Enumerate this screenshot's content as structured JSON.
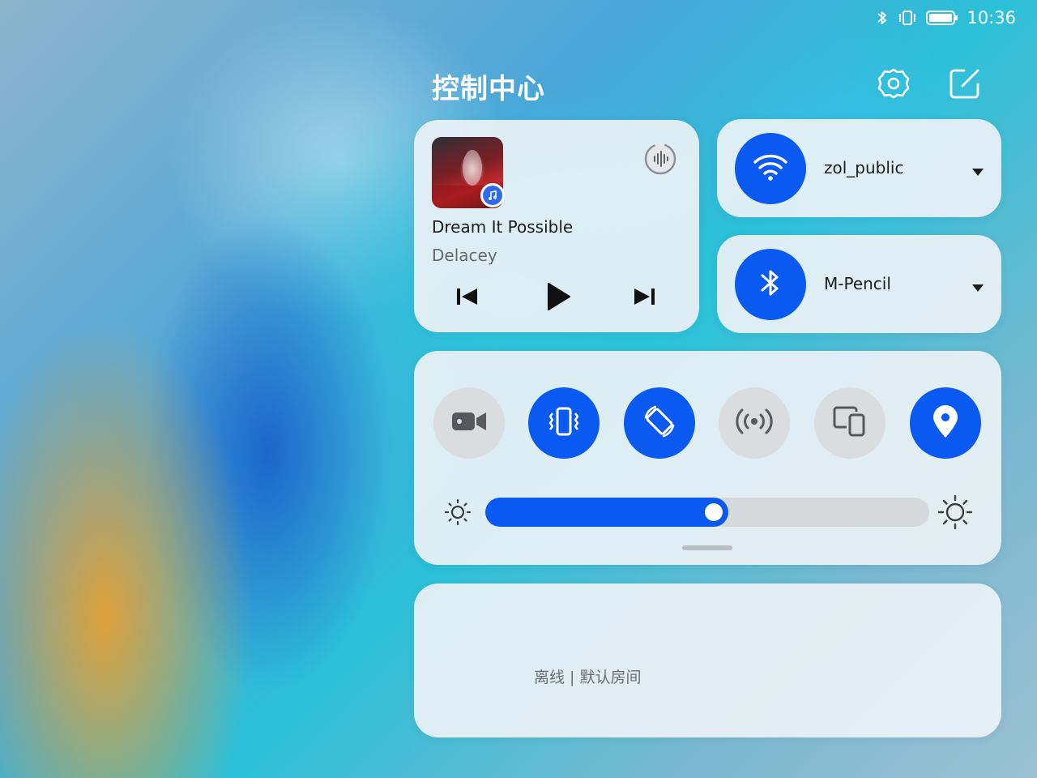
{
  "status_bar": {
    "time": "10:36",
    "icons": [
      "bluetooth-icon",
      "vibrate-icon",
      "battery-icon"
    ]
  },
  "control_center": {
    "title": "控制中心",
    "header_icons": [
      "gear-icon",
      "edit-icon"
    ]
  },
  "music": {
    "title": "Dream It Possible",
    "artist": "Delacey",
    "icons": [
      "album-art",
      "music-app-icon",
      "audio-output-icon",
      "previous-icon",
      "play-icon",
      "next-icon"
    ]
  },
  "wifi": {
    "network": "zol_public",
    "enabled": true
  },
  "bluetooth": {
    "device": "M-Pencil",
    "enabled": true
  },
  "toggles": [
    {
      "name": "screen-recorder",
      "icon": "video-camera-icon",
      "on": false
    },
    {
      "name": "vibration",
      "icon": "vibrate-icon",
      "on": true
    },
    {
      "name": "auto-rotate",
      "icon": "rotate-icon",
      "on": true
    },
    {
      "name": "hotspot",
      "icon": "hotspot-icon",
      "on": false
    },
    {
      "name": "multi-screen",
      "icon": "multi-device-icon",
      "on": false
    },
    {
      "name": "location",
      "icon": "location-pin-icon",
      "on": true
    }
  ],
  "brightness": {
    "level": 0.53
  },
  "smart_home": {
    "status": "离线 | 默认房间"
  },
  "colors": {
    "accent": "#0a59f0",
    "card": "#ecf2f6",
    "toggle_off": "#d9dde0"
  }
}
